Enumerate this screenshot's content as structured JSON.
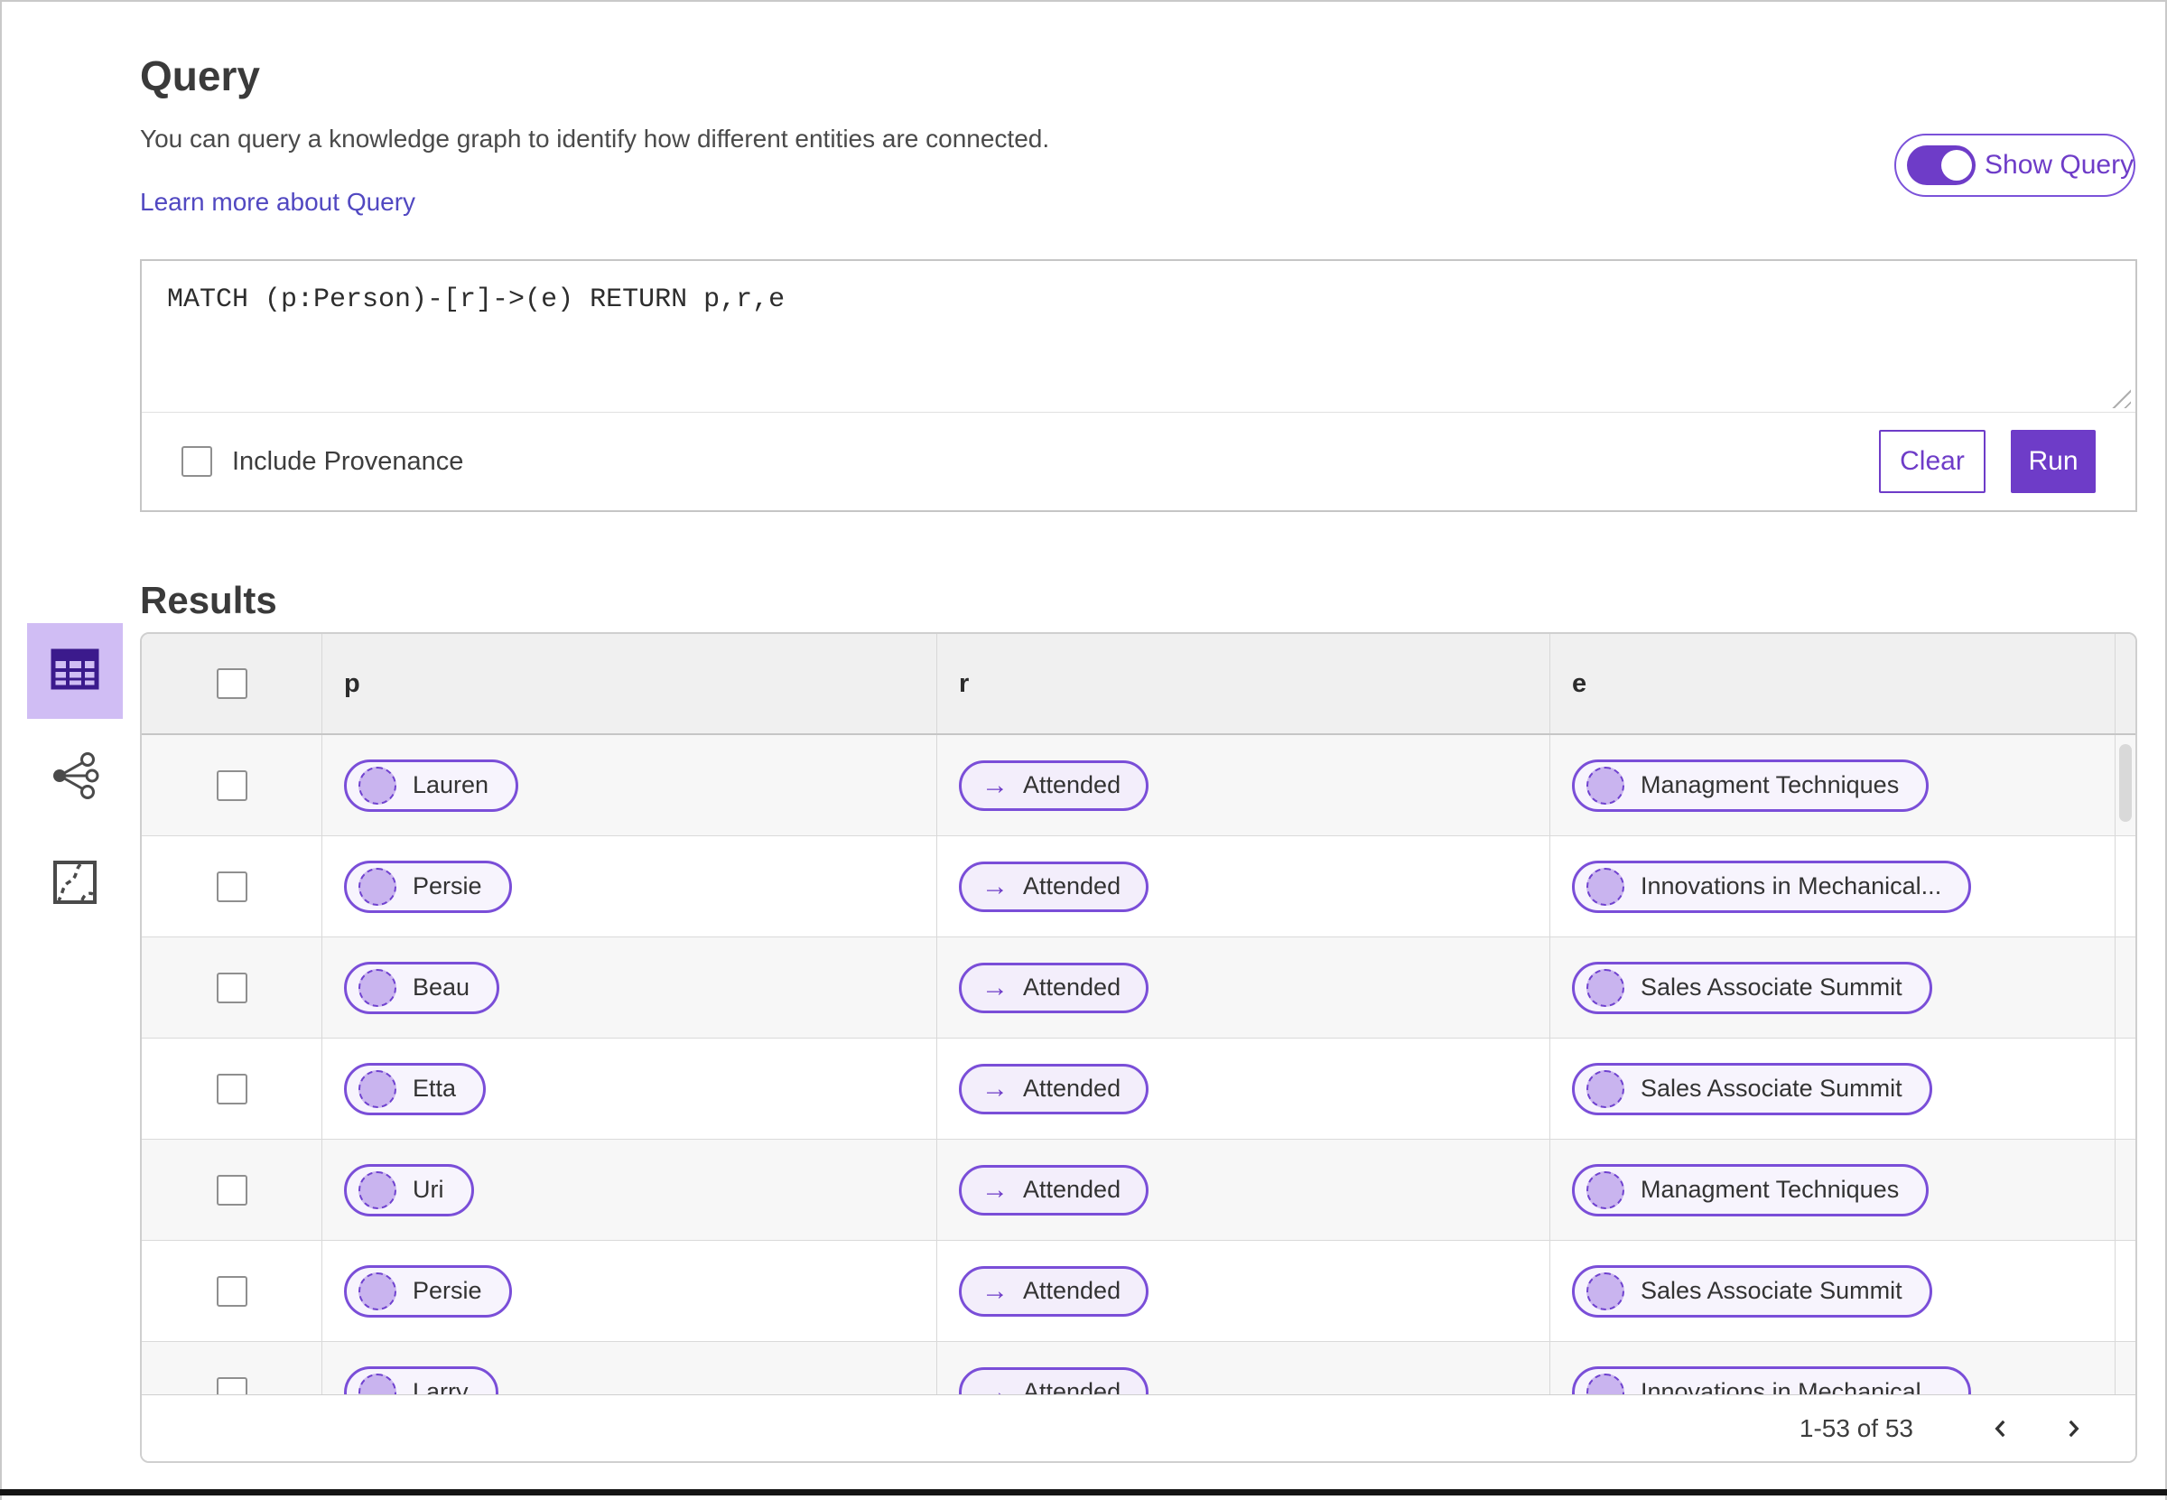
{
  "header": {
    "title": "Query",
    "description": "You can query a knowledge graph to identify how different entities are connected.",
    "learn_more_link": "Learn more about Query",
    "show_query_label": "Show Query",
    "show_query_toggle_state": "on"
  },
  "query_editor": {
    "query_text": "MATCH (p:Person)-[r]->(e) RETURN p,r,e",
    "include_provenance_label": "Include Provenance",
    "include_provenance_checked": false,
    "clear_label": "Clear",
    "run_label": "Run"
  },
  "results": {
    "title": "Results",
    "view_tabs": [
      {
        "name": "table-view",
        "icon": "table-icon",
        "selected": true
      },
      {
        "name": "graph-view",
        "icon": "network-icon",
        "selected": false
      },
      {
        "name": "map-view",
        "icon": "map-route-icon",
        "selected": false
      }
    ],
    "table": {
      "columns": [
        "p",
        "r",
        "e"
      ],
      "rows": [
        {
          "p": "Lauren",
          "r": "Attended",
          "e": "Managment Techniques"
        },
        {
          "p": "Persie",
          "r": "Attended",
          "e": "Innovations in Mechanical..."
        },
        {
          "p": "Beau",
          "r": "Attended",
          "e": "Sales Associate Summit"
        },
        {
          "p": "Etta",
          "r": "Attended",
          "e": "Sales Associate Summit"
        },
        {
          "p": "Uri",
          "r": "Attended",
          "e": "Managment Techniques"
        },
        {
          "p": "Persie",
          "r": "Attended",
          "e": "Sales Associate Summit"
        },
        {
          "p": "Larry",
          "r": "Attended",
          "e": "Innovations in Mechanical..."
        }
      ]
    },
    "pagination": {
      "range_label": "1-53 of 53"
    }
  },
  "icons": {
    "edge_arrow": "→"
  },
  "colors": {
    "accent_purple": "#6e3cc8",
    "pill_border": "#7a4ed8",
    "node_pill_bg": "#f7f4fd",
    "edge_pill_bg": "#f3eefb",
    "node_circle_fill": "#c9b4ef",
    "selected_tab_bg": "#d0bdf4",
    "link_color": "#5148c1",
    "header_row_bg": "#f0f0f0",
    "stripe_row_bg": "#f7f7f7"
  }
}
